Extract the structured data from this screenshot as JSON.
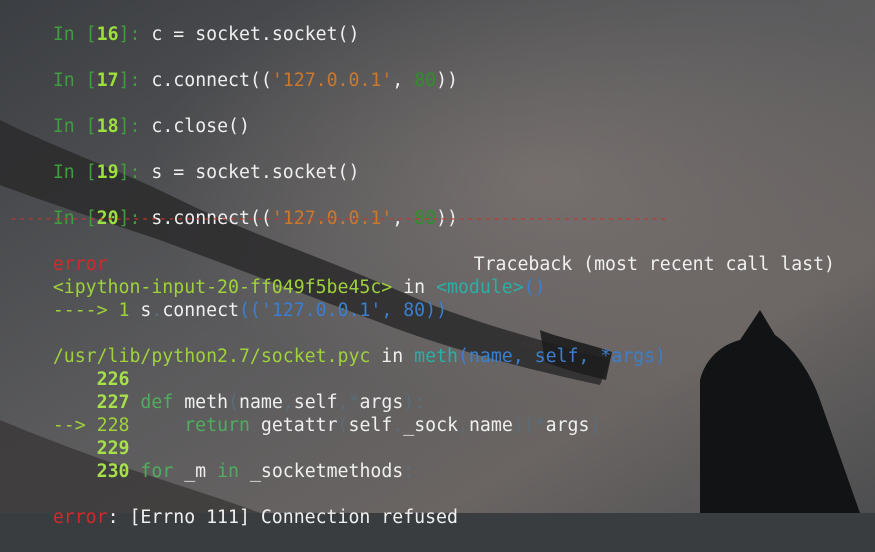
{
  "prompts": [
    {
      "in": "In ",
      "lb": "[",
      "n": "16",
      "rb": "]: ",
      "code": [
        {
          "t": "c = socket.socket()",
          "c": "code"
        }
      ]
    },
    {
      "in": "In ",
      "lb": "[",
      "n": "17",
      "rb": "]: ",
      "code": [
        {
          "t": "c.connect((",
          "c": "code"
        },
        {
          "t": "'127.0.0.1'",
          "c": "str"
        },
        {
          "t": ", ",
          "c": "code"
        },
        {
          "t": "80",
          "c": "num"
        },
        {
          "t": "))",
          "c": "code"
        }
      ]
    },
    {
      "in": "In ",
      "lb": "[",
      "n": "18",
      "rb": "]: ",
      "code": [
        {
          "t": "c.close()",
          "c": "code"
        }
      ]
    },
    {
      "in": "In ",
      "lb": "[",
      "n": "19",
      "rb": "]: ",
      "code": [
        {
          "t": "s = socket.socket()",
          "c": "code"
        }
      ]
    },
    {
      "in": "In ",
      "lb": "[",
      "n": "20",
      "rb": "]: ",
      "code": [
        {
          "t": "s.connect((",
          "c": "code"
        },
        {
          "t": "'127.0.0.1'",
          "c": "str"
        },
        {
          "t": ", ",
          "c": "code"
        },
        {
          "t": "80",
          "c": "num"
        },
        {
          "t": "))",
          "c": "code"
        }
      ]
    }
  ],
  "separator": "---------------------------------------------------------------------------",
  "traceback": {
    "error_name": "error",
    "header": "Traceback (most recent call last)",
    "input_ref": "<ipython-input-20-ff049f5be45c>",
    "in_kw": " in ",
    "module": "<module>",
    "module_parens": "()",
    "arrow1": "----> 1 ",
    "call_obj": "s",
    "call_dot": ".",
    "call_fn": "connect",
    "call_args": "(('127.0.0.1', 80))",
    "file_path": "/usr/lib/python2.7/socket.pyc",
    "meth_name": "meth",
    "meth_sig": "(name, self, *args)",
    "src_lines": [
      {
        "prefix": "    ",
        "num": "226",
        "parts": []
      },
      {
        "prefix": "    ",
        "num": "227",
        "parts": [
          {
            "t": " def ",
            "c": "green2"
          },
          {
            "t": "meth",
            "c": "white"
          },
          {
            "t": "(",
            "c": "dim"
          },
          {
            "t": "name",
            "c": "white"
          },
          {
            "t": ",",
            "c": "dim"
          },
          {
            "t": "self",
            "c": "white"
          },
          {
            "t": ",*",
            "c": "dim"
          },
          {
            "t": "args",
            "c": "white"
          },
          {
            "t": "):",
            "c": "dim"
          }
        ]
      },
      {
        "prefix": "--> ",
        "num": "228",
        "parts": [
          {
            "t": "     return ",
            "c": "green2"
          },
          {
            "t": "getattr",
            "c": "white"
          },
          {
            "t": "(",
            "c": "dim"
          },
          {
            "t": "self",
            "c": "white"
          },
          {
            "t": ".",
            "c": "dim"
          },
          {
            "t": "_sock",
            "c": "white"
          },
          {
            "t": ",",
            "c": "dim"
          },
          {
            "t": "name",
            "c": "white"
          },
          {
            "t": ")(*",
            "c": "dim"
          },
          {
            "t": "args",
            "c": "white"
          },
          {
            "t": ")",
            "c": "dim"
          }
        ]
      },
      {
        "prefix": "    ",
        "num": "229",
        "parts": []
      },
      {
        "prefix": "    ",
        "num": "230",
        "parts": [
          {
            "t": " for ",
            "c": "green2"
          },
          {
            "t": "_m ",
            "c": "white"
          },
          {
            "t": "in ",
            "c": "green2"
          },
          {
            "t": "_socketmethods",
            "c": "white"
          },
          {
            "t": ":",
            "c": "dim"
          }
        ]
      }
    ],
    "final_error": "error",
    "final_msg": ": [Errno 111] Connection refused"
  }
}
